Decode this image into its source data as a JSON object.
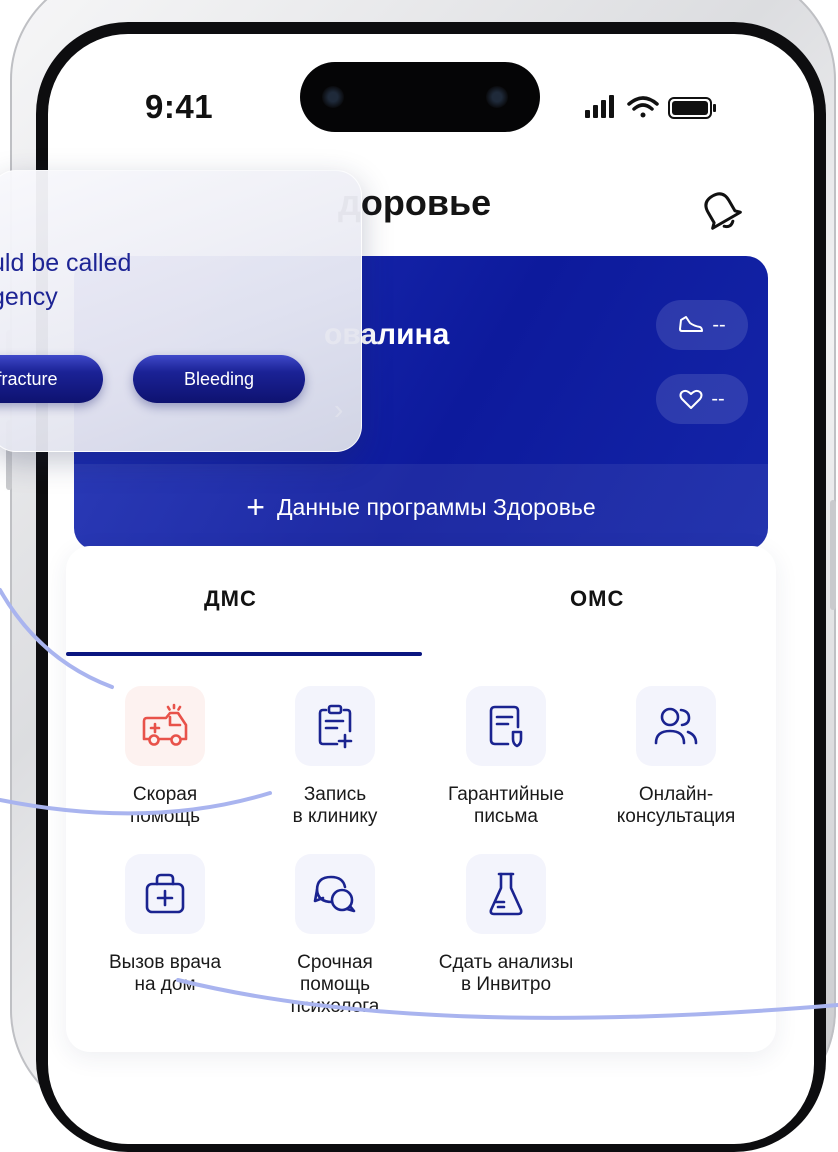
{
  "status_bar": {
    "time": "9:41"
  },
  "header": {
    "title": "доровье",
    "bell_icon": "bell-icon"
  },
  "banner": {
    "name": "овалина",
    "arrow": "›",
    "steps_value": "--",
    "heart_value": "--",
    "add_label": "Данные программы Здоровье"
  },
  "tabs": [
    {
      "label": "ДМС",
      "active": true
    },
    {
      "label": "ОМС",
      "active": false
    }
  ],
  "services": [
    {
      "label": "Скорая\nпомощь",
      "icon": "ambulance-icon",
      "highlight": "#e8524a"
    },
    {
      "label": "Запись\nв клинику",
      "icon": "clipboard-plus-icon"
    },
    {
      "label": "Гарантийные\nписьма",
      "icon": "document-shield-icon"
    },
    {
      "label": "Онлайн-\nконсультация",
      "icon": "users-icon"
    },
    {
      "label": "Вызов врача\nна дом",
      "icon": "medical-bag-icon"
    },
    {
      "label": "Срочная\nпомощь\nпсихолога",
      "icon": "chat-bubbles-icon"
    },
    {
      "label": "Сдать анализы\nв Инвитро",
      "icon": "flask-icon"
    }
  ],
  "popup": {
    "line1": "uld be called",
    "line2": "gency",
    "chips": [
      "fracture",
      "Bleeding"
    ]
  },
  "colors": {
    "accent": "#0a1680",
    "banner": "#1425a8",
    "icon_blue": "#1a2390",
    "icon_red": "#e8524a",
    "connector": "#a9b4ef"
  }
}
